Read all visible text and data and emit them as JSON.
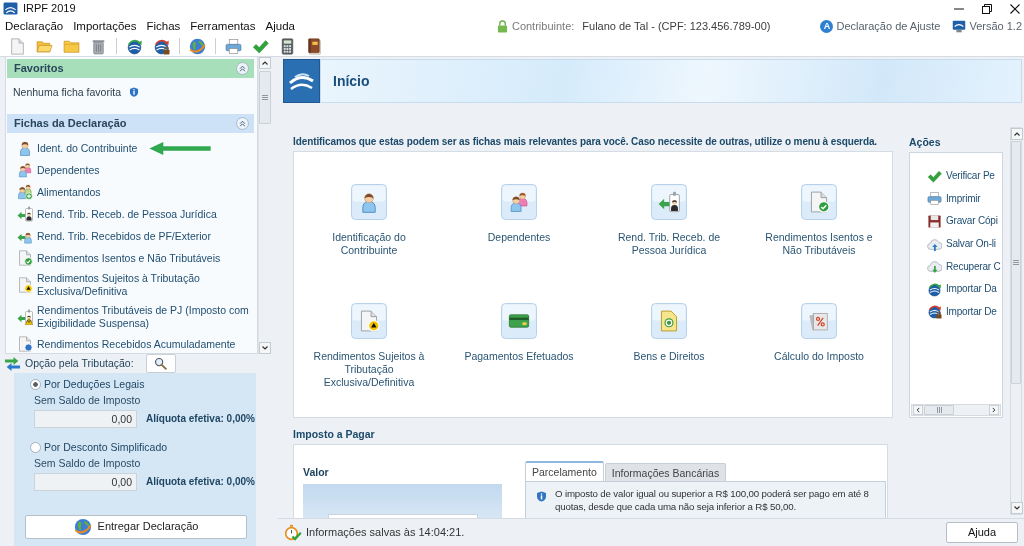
{
  "window": {
    "title": "IRPF 2019"
  },
  "menu": [
    {
      "label": "Declaração"
    },
    {
      "label": "Importações"
    },
    {
      "label": "Fichas"
    },
    {
      "label": "Ferramentas"
    },
    {
      "label": "Ajuda"
    }
  ],
  "header_info": {
    "taxpayer_label": "Contribuinte:",
    "taxpayer": "Fulano de Tal - (CPF: 123.456.789-00)",
    "declaration_badge": "A",
    "declaration_type": "Declaração de Ajuste",
    "version": "Versão 1.2"
  },
  "sidebar": {
    "favorites": {
      "title": "Favoritos",
      "expanded": true,
      "empty_text": "Nenhuma ficha favorita"
    },
    "forms": {
      "title": "Fichas da Declaração",
      "expanded": true,
      "items": [
        {
          "label": "Ident. do Contribuinte",
          "pointed_at": true
        },
        {
          "label": "Dependentes",
          "pointed_at": false
        },
        {
          "label": "Alimentandos",
          "pointed_at": false
        },
        {
          "label": "Rend. Trib. Receb. de Pessoa Jurídica",
          "pointed_at": false
        },
        {
          "label": "Rend. Trib. Recebidos de PF/Exterior",
          "pointed_at": false
        },
        {
          "label": "Rendimentos Isentos e Não Tributáveis",
          "pointed_at": false
        },
        {
          "label": "Rendimentos Sujeitos à Tributação Exclusiva/Definitiva",
          "pointed_at": false
        },
        {
          "label": "Rendimentos Tributáveis de PJ (Imposto com Exigibilidade Suspensa)",
          "pointed_at": false
        },
        {
          "label": "Rendimentos Recebidos Acumuladamente",
          "pointed_at": false
        }
      ]
    }
  },
  "tax_option": {
    "title": "Opção pela Tributação:",
    "options": [
      {
        "label": "Por Deduções Legais",
        "selected": true,
        "balance_label": "Sem Saldo de Imposto",
        "value": "0,00",
        "rate": "Alíquota efetiva: 0,00%"
      },
      {
        "label": "Por Desconto Simplificado",
        "selected": false,
        "balance_label": "Sem Saldo de Imposto",
        "value": "0,00",
        "rate": "Alíquota efetiva: 0,00%"
      }
    ],
    "submit_button": "Entregar Declaração"
  },
  "home": {
    "title": "Início",
    "intro": "Identificamos que estas podem ser as fichas mais relevantes para você. Caso necessite de outras, utilize o menu à esquerda.",
    "shortcuts": [
      {
        "label": "Identificação do Contribuinte"
      },
      {
        "label": "Dependentes"
      },
      {
        "label": "Rend. Trib. Receb. de Pessoa Jurídica"
      },
      {
        "label": "Rendimentos Isentos e Não Tributáveis"
      },
      {
        "label": "Rendimentos Sujeitos à Tributação Exclusiva/Definitiva"
      },
      {
        "label": "Pagamentos Efetuados"
      },
      {
        "label": "Bens e Direitos"
      },
      {
        "label": "Cálculo do Imposto"
      }
    ],
    "actions": {
      "title": "Ações",
      "items": [
        {
          "label": "Verificar Pe"
        },
        {
          "label": "Imprimir"
        },
        {
          "label": "Gravar Cópi"
        },
        {
          "label": "Salvar On-li"
        },
        {
          "label": "Recuperar C"
        },
        {
          "label": "Importar Da"
        },
        {
          "label": "Importar De"
        }
      ]
    }
  },
  "tax_due": {
    "title": "Imposto a Pagar",
    "value_label": "Valor",
    "tabs": [
      {
        "label": "Parcelamento",
        "selected": true
      },
      {
        "label": "Informações Bancárias",
        "selected": false
      }
    ],
    "note": "O imposto de valor igual ou superior a R$ 100,00 poderá ser pago em até 8 quotas, desde que cada uma não seja inferior a R$ 50,00."
  },
  "status_bar": {
    "message": "Informações salvas às 14:04:21.",
    "help_button": "Ajuda"
  }
}
